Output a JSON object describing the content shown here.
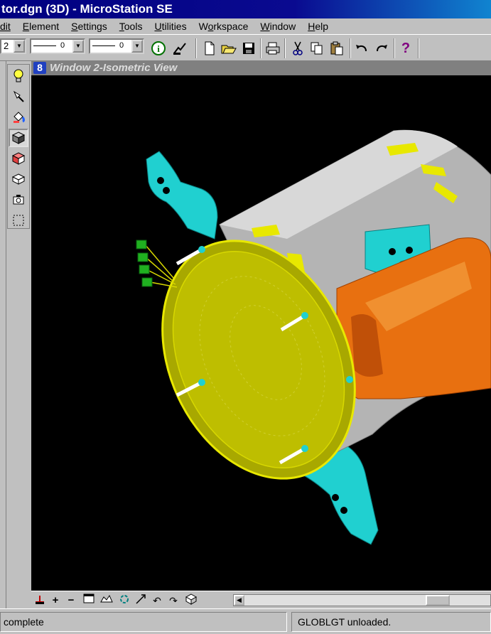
{
  "window": {
    "title": "tor.dgn (3D) - MicroStation SE"
  },
  "menu": {
    "items": [
      {
        "pre": "",
        "ul": "E",
        "post": "dit",
        "shown": "Edit"
      },
      {
        "pre": "",
        "ul": "E",
        "post": "lement"
      },
      {
        "pre": "",
        "ul": "S",
        "post": "ettings"
      },
      {
        "pre": "",
        "ul": "T",
        "post": "ools"
      },
      {
        "pre": "",
        "ul": "U",
        "post": "tilities"
      },
      {
        "pre": "W",
        "ul": "o",
        "post": "rkspace"
      },
      {
        "pre": "",
        "ul": "W",
        "post": "indow"
      },
      {
        "pre": "",
        "ul": "H",
        "post": "elp"
      }
    ]
  },
  "toolbar": {
    "level_value": "2",
    "line_style_value": "0",
    "line_weight_value": "0",
    "icons": [
      "info-icon",
      "place-icon",
      "new-file-icon",
      "open-icon",
      "save-icon",
      "print-icon",
      "cut-icon",
      "copy-icon",
      "paste-icon",
      "undo-icon",
      "redo-icon",
      "help-icon"
    ]
  },
  "palette": {
    "icons": [
      "lightbulb-icon",
      "light-source-icon",
      "paint-bucket-icon",
      "shaded-cube-icon",
      "cube-render-icon",
      "isometric-cube-icon",
      "camera-icon",
      "fence-icon"
    ]
  },
  "view": {
    "title": "Window 2-Isometric View",
    "colors": {
      "background": "#000000",
      "housing": "#b8b8b8",
      "end_cap": "#c8c800",
      "brackets": "#20d0d0",
      "motor": "#e87010",
      "leads": "#20b020"
    }
  },
  "view_controls": {
    "icons": [
      "update-icon",
      "zoom-in-icon",
      "zoom-out-icon",
      "window-area-icon",
      "fit-view-icon",
      "rotate-icon",
      "pan-icon",
      "undo-view-icon",
      "redo-view-icon",
      "view-cube-icon"
    ]
  },
  "status": {
    "left": "complete",
    "right": "GLOBLGT unloaded."
  }
}
